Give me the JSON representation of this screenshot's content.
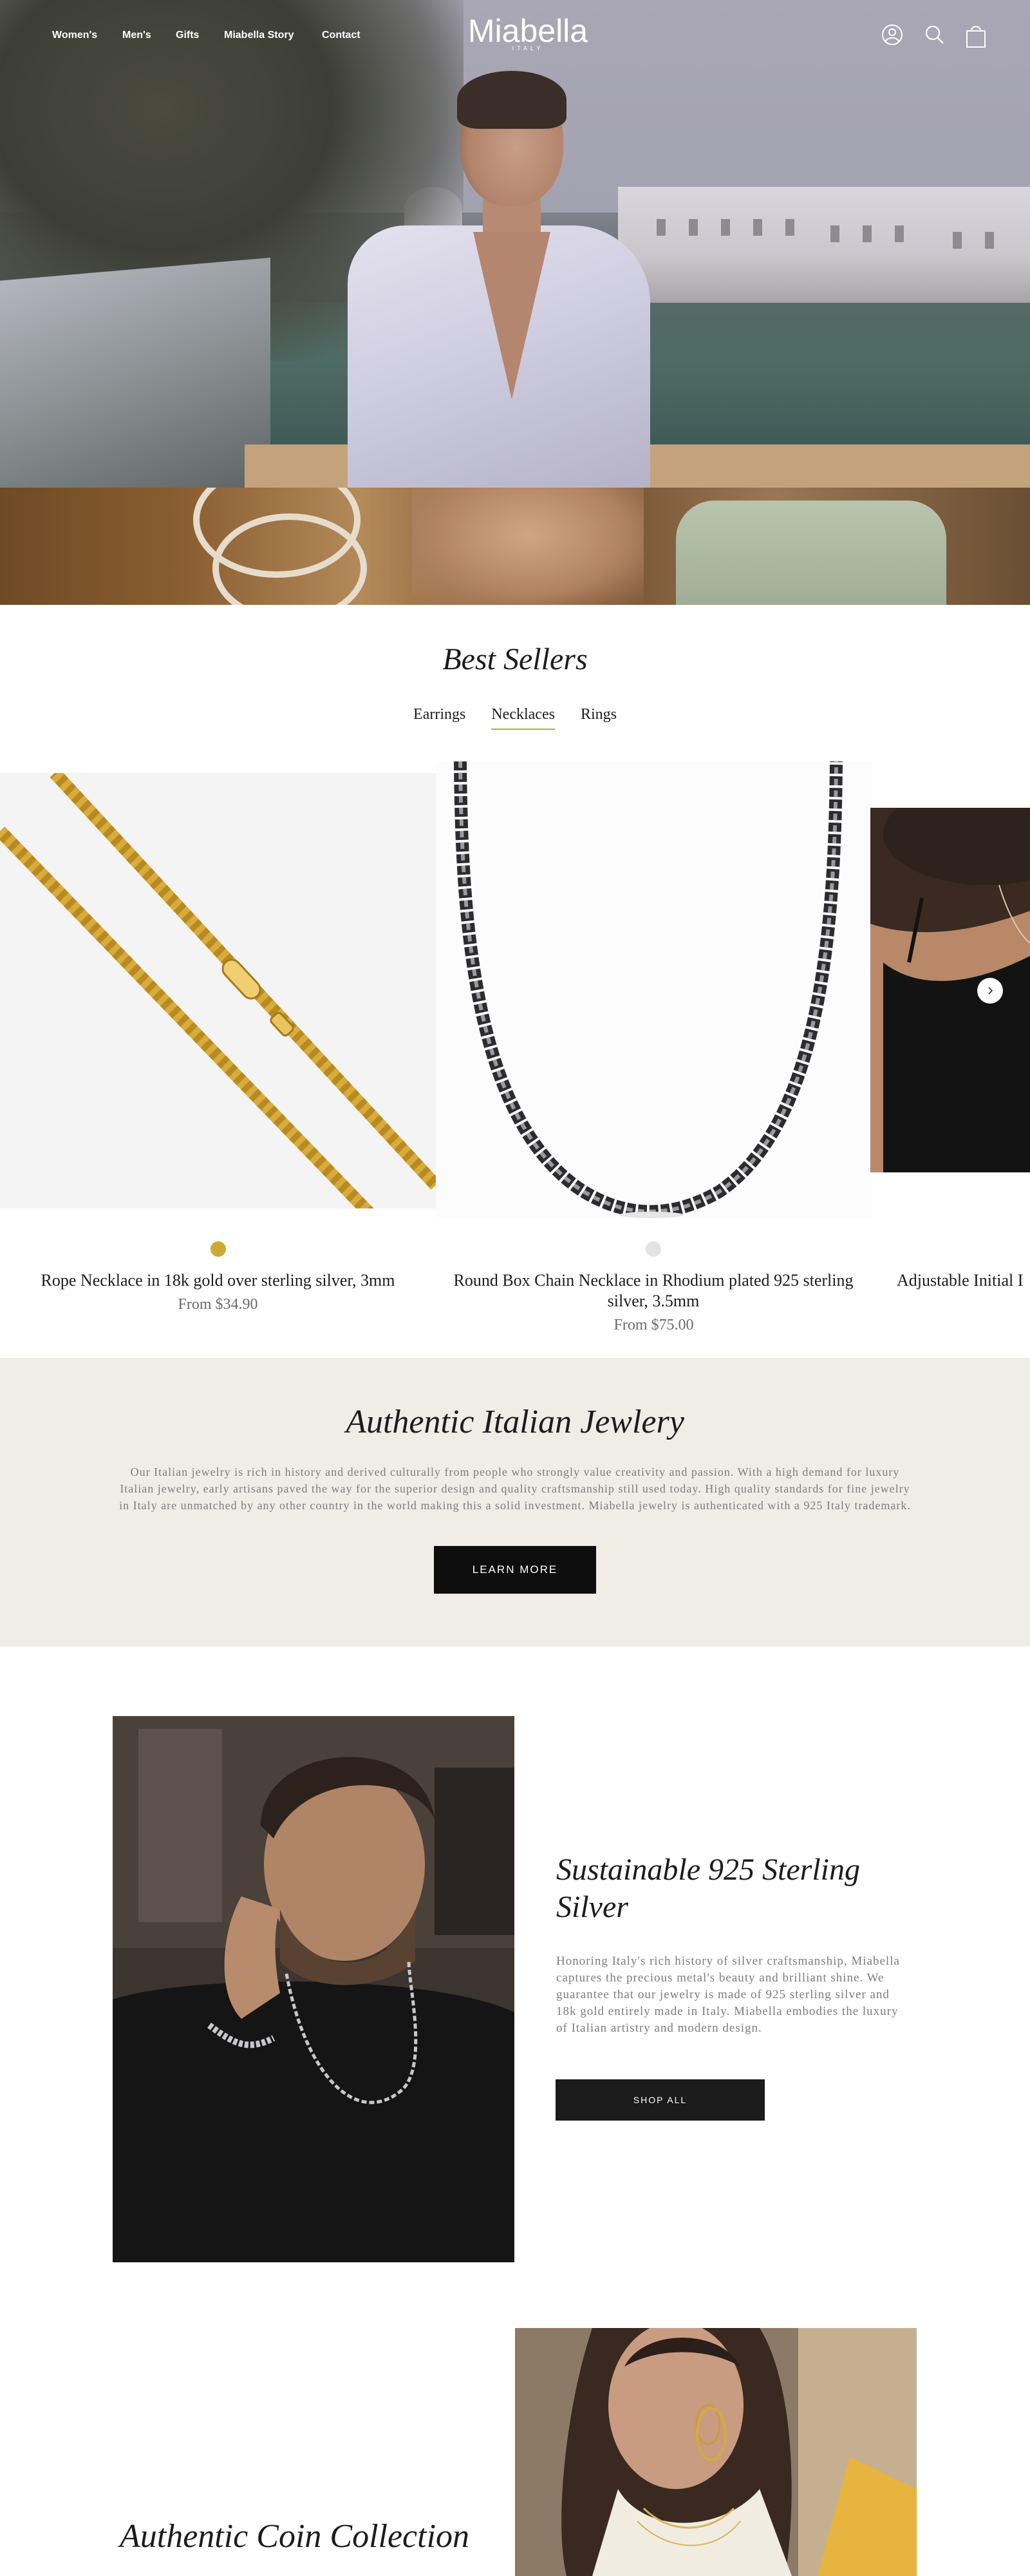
{
  "header": {
    "nav": [
      "Women's",
      "Men's",
      "Gifts",
      "Miabella Story",
      "Contact"
    ],
    "logo": {
      "name": "Miabella",
      "sub": "ITALY"
    },
    "icons": [
      "account-icon",
      "search-icon",
      "cart-icon"
    ]
  },
  "best_sellers": {
    "title": "Best Sellers",
    "tabs": [
      "Earrings",
      "Necklaces",
      "Rings"
    ],
    "active_tab": "Necklaces",
    "products": [
      {
        "name": "Rope Necklace in 18k gold over sterling silver, 3mm",
        "price": "From $34.90",
        "swatch_color": "#cfa934"
      },
      {
        "name": "Round Box Chain Necklace in Rhodium plated 925 sterling silver, 3.5mm",
        "price": "From $75.00",
        "swatch_color": "#e3e3e3"
      },
      {
        "name": "Adjustable Initial I",
        "price": ""
      }
    ]
  },
  "authentic": {
    "title": "Authentic Italian Jewlery",
    "body": "Our Italian jewelry is rich in history and derived culturally from people who strongly value creativity and passion. With a high demand for luxury Italian jewelry, early artisans paved the way for the superior design and quality craftsmanship still used today. High quality standards for fine jewelry in Italy are unmatched by any other country in the world making this a solid investment. Miabella jewelry is authenticated with a 925 Italy trademark.",
    "button": "LEARN MORE"
  },
  "sterling": {
    "title": "Sustainable 925 Sterling Silver",
    "body": "Honoring Italy's rich history of silver craftsmanship, Miabella captures the precious metal's beauty and brilliant shine. We guarantee that our jewelry is made of 925 sterling silver and 18k gold entirely made in Italy. Miabella embodies the luxury of Italian artistry and modern design.",
    "button": "SHOP ALL"
  },
  "coin": {
    "title": "Authentic Coin Collection"
  },
  "colors": {
    "accent_gold": "#c8a24b",
    "beige_section": "#f0ece6",
    "button_dark": "#0e0e0e"
  }
}
